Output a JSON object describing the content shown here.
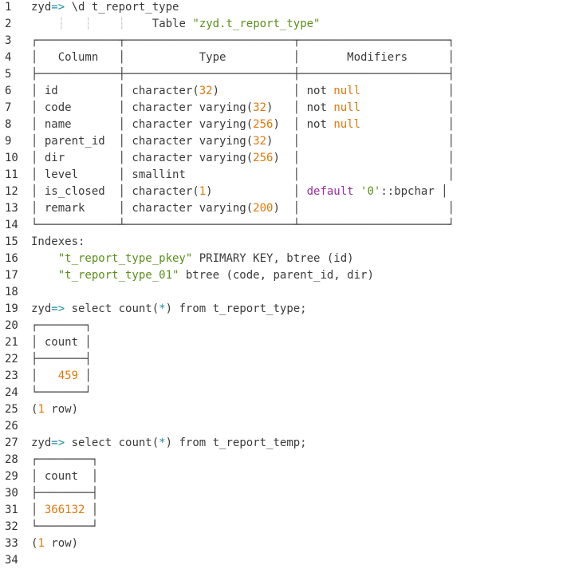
{
  "lines": [
    {
      "n": "1",
      "parts": [
        {
          "t": "zyd",
          "c": "plain"
        },
        {
          "t": "=>",
          "c": "kw"
        },
        {
          "t": " \\d t_report_type",
          "c": "plain"
        }
      ]
    },
    {
      "n": "2",
      "parts": [
        {
          "t": "    ",
          "c": "plain"
        },
        {
          "t": "┆",
          "c": "guide"
        },
        {
          "t": "   ",
          "c": "plain"
        },
        {
          "t": "┆",
          "c": "guide"
        },
        {
          "t": "    ",
          "c": "plain"
        },
        {
          "t": "┆",
          "c": "guide"
        },
        {
          "t": "    Table ",
          "c": "plain"
        },
        {
          "t": "\"zyd.t_report_type\"",
          "c": "str"
        }
      ]
    },
    {
      "n": "3",
      "parts": [
        {
          "t": "┌────────────┬─────────────────────────┬──────────────────────┐",
          "c": "plain"
        }
      ]
    },
    {
      "n": "4",
      "parts": [
        {
          "t": "│   Column   │           Type          │       Modifiers      │",
          "c": "plain"
        }
      ]
    },
    {
      "n": "5",
      "parts": [
        {
          "t": "├────────────┼─────────────────────────┼──────────────────────┤",
          "c": "plain"
        }
      ]
    },
    {
      "n": "6",
      "parts": [
        {
          "t": "│ id         │ character(",
          "c": "plain"
        },
        {
          "t": "32",
          "c": "num"
        },
        {
          "t": ")           │ not ",
          "c": "plain"
        },
        {
          "t": "null",
          "c": "num"
        },
        {
          "t": "             │",
          "c": "plain"
        }
      ]
    },
    {
      "n": "7",
      "parts": [
        {
          "t": "│ code       │ character varying(",
          "c": "plain"
        },
        {
          "t": "32",
          "c": "num"
        },
        {
          "t": ")   │ not ",
          "c": "plain"
        },
        {
          "t": "null",
          "c": "num"
        },
        {
          "t": "             │",
          "c": "plain"
        }
      ]
    },
    {
      "n": "8",
      "parts": [
        {
          "t": "│ name       │ character varying(",
          "c": "plain"
        },
        {
          "t": "256",
          "c": "num"
        },
        {
          "t": ")  │ not ",
          "c": "plain"
        },
        {
          "t": "null",
          "c": "num"
        },
        {
          "t": "             │",
          "c": "plain"
        }
      ]
    },
    {
      "n": "9",
      "parts": [
        {
          "t": "│ parent_id  │ character varying(",
          "c": "plain"
        },
        {
          "t": "32",
          "c": "num"
        },
        {
          "t": ")   │                      │",
          "c": "plain"
        }
      ]
    },
    {
      "n": "10",
      "parts": [
        {
          "t": "│ dir        │ character varying(",
          "c": "plain"
        },
        {
          "t": "256",
          "c": "num"
        },
        {
          "t": ")  │                      │",
          "c": "plain"
        }
      ]
    },
    {
      "n": "11",
      "parts": [
        {
          "t": "│ level      │ smallint                │                      │",
          "c": "plain"
        }
      ]
    },
    {
      "n": "12",
      "parts": [
        {
          "t": "│ is_closed  │ character(",
          "c": "plain"
        },
        {
          "t": "1",
          "c": "num"
        },
        {
          "t": ")            │ ",
          "c": "plain"
        },
        {
          "t": "default",
          "c": "kwpurple"
        },
        {
          "t": " ",
          "c": "plain"
        },
        {
          "t": "'0'",
          "c": "str"
        },
        {
          "t": "::bpchar │",
          "c": "plain"
        }
      ]
    },
    {
      "n": "13",
      "parts": [
        {
          "t": "│ remark     │ character varying(",
          "c": "plain"
        },
        {
          "t": "200",
          "c": "num"
        },
        {
          "t": ")  │                      │",
          "c": "plain"
        }
      ]
    },
    {
      "n": "14",
      "parts": [
        {
          "t": "└────────────┴─────────────────────────┴──────────────────────┘",
          "c": "plain"
        }
      ]
    },
    {
      "n": "15",
      "parts": [
        {
          "t": "Indexes:",
          "c": "plain"
        }
      ]
    },
    {
      "n": "16",
      "parts": [
        {
          "t": "    ",
          "c": "plain"
        },
        {
          "t": "\"t_report_type_pkey\"",
          "c": "str"
        },
        {
          "t": " PRIMARY KEY, btree (id)",
          "c": "plain"
        }
      ]
    },
    {
      "n": "17",
      "parts": [
        {
          "t": "    ",
          "c": "plain"
        },
        {
          "t": "\"t_report_type_01\"",
          "c": "str"
        },
        {
          "t": " btree (code, parent_id, dir)",
          "c": "plain"
        }
      ]
    },
    {
      "n": "18",
      "parts": []
    },
    {
      "n": "19",
      "parts": [
        {
          "t": "zyd",
          "c": "plain"
        },
        {
          "t": "=>",
          "c": "kw"
        },
        {
          "t": " select count(",
          "c": "plain"
        },
        {
          "t": "*",
          "c": "kw"
        },
        {
          "t": ") from t_report_type;",
          "c": "plain"
        }
      ]
    },
    {
      "n": "20",
      "parts": [
        {
          "t": "┌───────┐",
          "c": "plain"
        }
      ]
    },
    {
      "n": "21",
      "parts": [
        {
          "t": "│ count │",
          "c": "plain"
        }
      ]
    },
    {
      "n": "22",
      "parts": [
        {
          "t": "├───────┤",
          "c": "plain"
        }
      ]
    },
    {
      "n": "23",
      "parts": [
        {
          "t": "│   ",
          "c": "plain"
        },
        {
          "t": "459",
          "c": "num"
        },
        {
          "t": " │",
          "c": "plain"
        }
      ]
    },
    {
      "n": "24",
      "parts": [
        {
          "t": "└───────┘",
          "c": "plain"
        }
      ]
    },
    {
      "n": "25",
      "parts": [
        {
          "t": "(",
          "c": "plain"
        },
        {
          "t": "1",
          "c": "num"
        },
        {
          "t": " row)",
          "c": "plain"
        }
      ]
    },
    {
      "n": "26",
      "parts": []
    },
    {
      "n": "27",
      "parts": [
        {
          "t": "zyd",
          "c": "plain"
        },
        {
          "t": "=>",
          "c": "kw"
        },
        {
          "t": " select count(",
          "c": "plain"
        },
        {
          "t": "*",
          "c": "kw"
        },
        {
          "t": ") from t_report_temp;",
          "c": "plain"
        }
      ]
    },
    {
      "n": "28",
      "parts": [
        {
          "t": "┌────────┐",
          "c": "plain"
        }
      ]
    },
    {
      "n": "29",
      "parts": [
        {
          "t": "│ count  │",
          "c": "plain"
        }
      ]
    },
    {
      "n": "30",
      "parts": [
        {
          "t": "├────────┤",
          "c": "plain"
        }
      ]
    },
    {
      "n": "31",
      "parts": [
        {
          "t": "│ ",
          "c": "plain"
        },
        {
          "t": "366132",
          "c": "num"
        },
        {
          "t": " │",
          "c": "plain"
        }
      ]
    },
    {
      "n": "32",
      "parts": [
        {
          "t": "└────────┘",
          "c": "plain"
        }
      ]
    },
    {
      "n": "33",
      "parts": [
        {
          "t": "(",
          "c": "plain"
        },
        {
          "t": "1",
          "c": "num"
        },
        {
          "t": " row)",
          "c": "plain"
        }
      ]
    },
    {
      "n": "34",
      "parts": []
    }
  ],
  "colors": {
    "keyword": "#1f8ea3",
    "string": "#5a8f1a",
    "number": "#e0780a",
    "default_keyword": "#9a2f9a",
    "text": "#3a3a3a",
    "background": "#ffffff"
  }
}
